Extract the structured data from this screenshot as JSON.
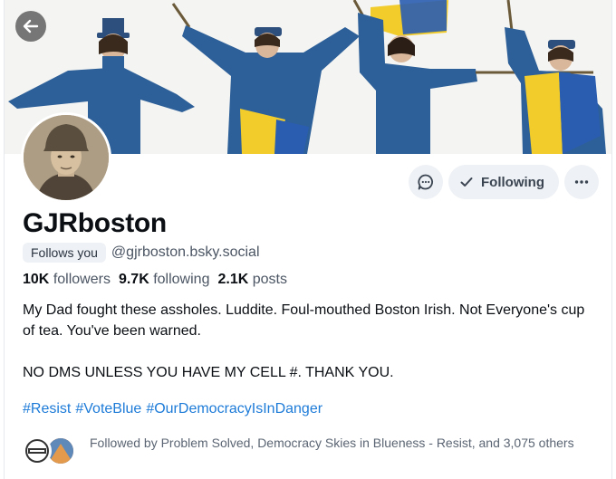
{
  "profile": {
    "display_name": "GJRboston",
    "follows_you_label": "Follows you",
    "handle": "@gjrboston.bsky.social",
    "stats": {
      "followers_count": "10K",
      "followers_label": "followers",
      "following_count": "9.7K",
      "following_label": "following",
      "posts_count": "2.1K",
      "posts_label": "posts"
    },
    "bio_line1": "My Dad fought these assholes. Luddite. Foul-mouthed Boston Irish.  Not Everyone's cup of tea. You've been warned.",
    "bio_line2": "NO DMS UNLESS YOU HAVE MY CELL #.  THANK YOU.",
    "hashtags": [
      "#Resist",
      "#VoteBlue",
      "#OurDemocracyIsInDanger"
    ],
    "followed_by": "Followed by Problem Solved, Democracy Skies in Blueness - Resist, and 3,075 others"
  },
  "actions": {
    "message_icon": "chat-bubble-icon",
    "following_label": "Following",
    "more_icon": "more-dots-icon"
  },
  "icons": {
    "back": "arrow-left-icon",
    "check": "check-icon"
  },
  "colors": {
    "hashtag": "#1d7bd8",
    "button_bg": "#eef1f5",
    "flag_blue": "#2a5db0",
    "flag_yellow": "#f2cc2b",
    "costume_blue": "#2d5f98"
  }
}
